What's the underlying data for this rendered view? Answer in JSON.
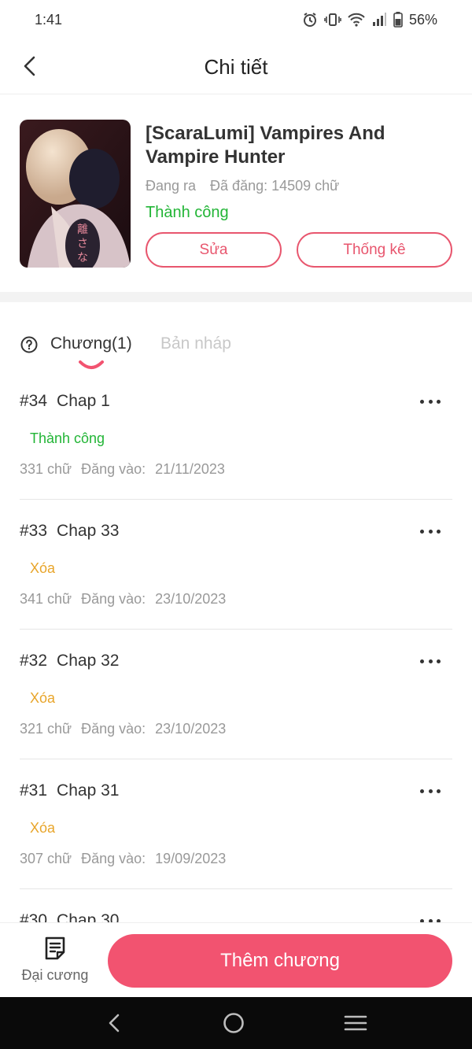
{
  "status_bar": {
    "time": "1:41",
    "battery": "56%",
    "icons": [
      "alarm-icon",
      "vibrate-icon",
      "wifi-icon",
      "signal-icon",
      "battery-icon"
    ]
  },
  "header": {
    "title": "Chi tiết",
    "back_icon": "chevron-left-icon"
  },
  "book": {
    "title": "[ScaraLumi] Vampires And Vampire Hunter",
    "state": "Đang ra",
    "words_posted": "Đã đăng: 14509 chữ",
    "status": "Thành công",
    "edit_label": "Sửa",
    "stats_label": "Thống kê",
    "cover_text": "離さな"
  },
  "tabs": {
    "chapters_label": "Chương(1)",
    "drafts_label": "Bản nháp"
  },
  "chapters": [
    {
      "number": "#34",
      "name": "Chap 1",
      "status": "Thành công",
      "words": "331 chữ",
      "posted_label": "Đăng vào:",
      "date": "21/11/2023"
    },
    {
      "number": "#33",
      "name": "Chap 33",
      "status": "Xóa",
      "words": "341 chữ",
      "posted_label": "Đăng vào:",
      "date": "23/10/2023"
    },
    {
      "number": "#32",
      "name": "Chap 32",
      "status": "Xóa",
      "words": "321 chữ",
      "posted_label": "Đăng vào:",
      "date": "23/10/2023"
    },
    {
      "number": "#31",
      "name": "Chap 31",
      "status": "Xóa",
      "words": "307 chữ",
      "posted_label": "Đăng vào:",
      "date": "19/09/2023"
    },
    {
      "number": "#30",
      "name": "Chap 30",
      "status": "",
      "words": "",
      "posted_label": "",
      "date": ""
    }
  ],
  "bottom_bar": {
    "outline_label": "Đại cương",
    "add_chapter_label": "Thêm chương"
  },
  "colors": {
    "accent": "#f25370",
    "success": "#22b536",
    "deleted": "#e8a52a",
    "muted": "#999999"
  }
}
